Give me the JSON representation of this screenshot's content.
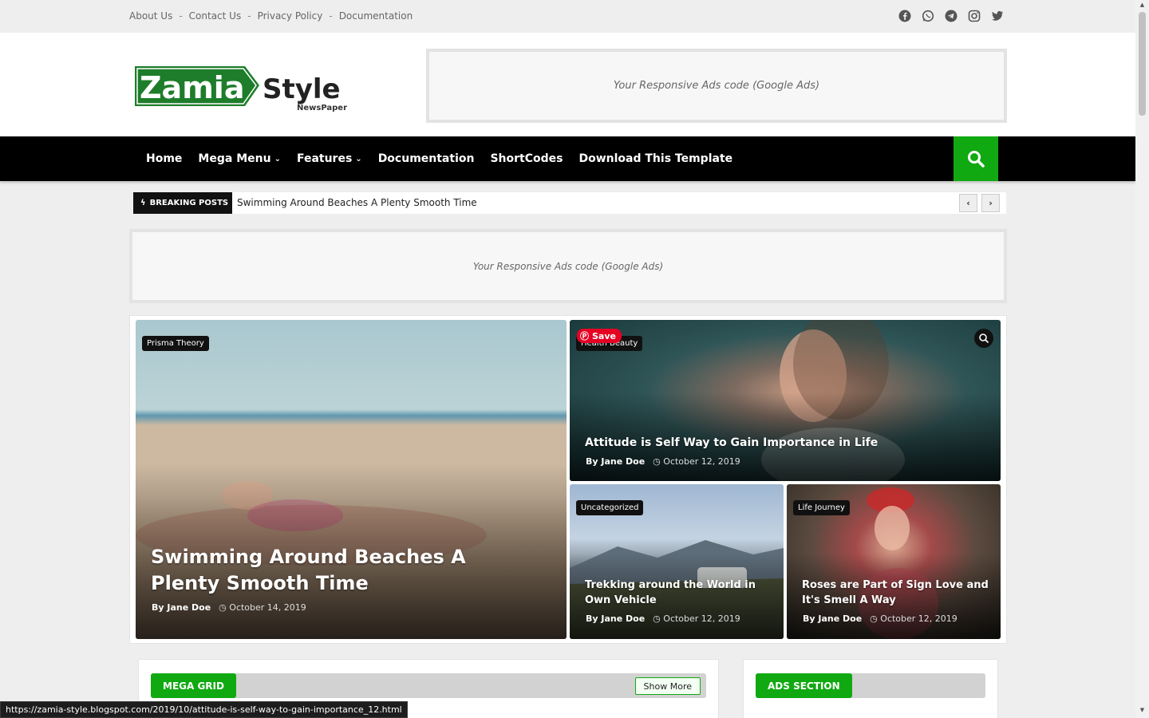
{
  "topbar": {
    "links": [
      "About Us",
      "Contact Us",
      "Privacy Policy",
      "Documentation"
    ],
    "separator": "-",
    "social_icons": [
      "facebook-icon",
      "whatsapp-icon",
      "telegram-icon",
      "instagram-icon",
      "twitter-icon"
    ]
  },
  "header": {
    "logo_main": "Zamia",
    "logo_accent": "Style",
    "logo_sub": "NewsPaper",
    "ad_text": "Your Responsive Ads code (Google Ads)"
  },
  "nav": {
    "items": [
      {
        "label": "Home",
        "has_dropdown": false
      },
      {
        "label": "Mega Menu",
        "has_dropdown": true
      },
      {
        "label": "Features",
        "has_dropdown": true
      },
      {
        "label": "Documentation",
        "has_dropdown": false
      },
      {
        "label": "ShortCodes",
        "has_dropdown": false
      },
      {
        "label": "Download This Template",
        "has_dropdown": false
      }
    ],
    "search_icon": "search-icon"
  },
  "breaking": {
    "label": "BREAKING POSTS",
    "text": "Swimming Around Beaches A Plenty Smooth Time",
    "prev": "‹",
    "next": "›"
  },
  "ad_mid": {
    "text": "Your Responsive Ads code (Google Ads)"
  },
  "featured": [
    {
      "tag": "Prisma Theory",
      "title": "Swimming Around Beaches A Plenty Smooth Time",
      "author": "By Jane Doe",
      "date": "October 14, 2019"
    },
    {
      "tag": "Health Beauty",
      "title": "Attitude is Self Way to Gain Importance in Life",
      "author": "By Jane Doe",
      "date": "October 12, 2019",
      "save_label": "Save"
    },
    {
      "tag": "Uncategorized",
      "title": "Trekking around the World in Own Vehicle",
      "author": "By Jane Doe",
      "date": "October 12, 2019"
    },
    {
      "tag": "Life Journey",
      "title": "Roses are Part of Sign Love and It's Smell A Way",
      "author": "By Jane Doe",
      "date": "October 12, 2019"
    }
  ],
  "sections": {
    "mega_grid": {
      "label": "MEGA GRID",
      "show_more": "Show More"
    },
    "ads_section": {
      "label": "ADS SECTION"
    }
  },
  "status_url": "https://zamia-style.blogspot.com/2019/10/attitude-is-self-way-to-gain-importance_12.html",
  "colors": {
    "accent": "#11a911",
    "nav_bg": "#000000",
    "tag_bg": "#111111",
    "pinterest": "#e60023"
  }
}
